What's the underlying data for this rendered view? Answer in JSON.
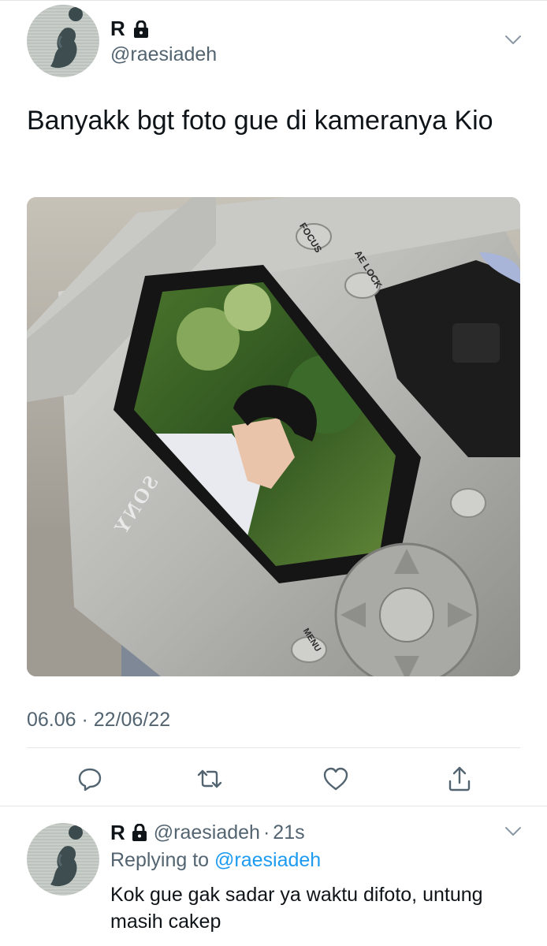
{
  "tweet": {
    "author_name": "R",
    "handle": "@raesiadeh",
    "text": "Banyakk bgt foto gue di kameranya Kio",
    "timestamp": "06.06 · 22/06/22",
    "media": {
      "labels": {
        "focus": "FOCUS",
        "ae_lock": "AE LOCK",
        "menu": "MENU",
        "brand": "SONY"
      }
    },
    "actions": {
      "reply_icon": "reply-icon",
      "retweet_icon": "retweet-icon",
      "like_icon": "heart-icon",
      "share_icon": "share-icon"
    }
  },
  "reply": {
    "author_name": "R",
    "handle": "@raesiadeh",
    "separator": "·",
    "time": "21s",
    "replying_prefix": "Replying to",
    "replying_to": "@raesiadeh",
    "text": "Kok gue gak sadar ya waktu difoto, untung masih cakep"
  },
  "colors": {
    "text_primary": "#0f1419",
    "text_secondary": "#536471",
    "link": "#1d9bf0",
    "divider": "#e6e6e6"
  }
}
